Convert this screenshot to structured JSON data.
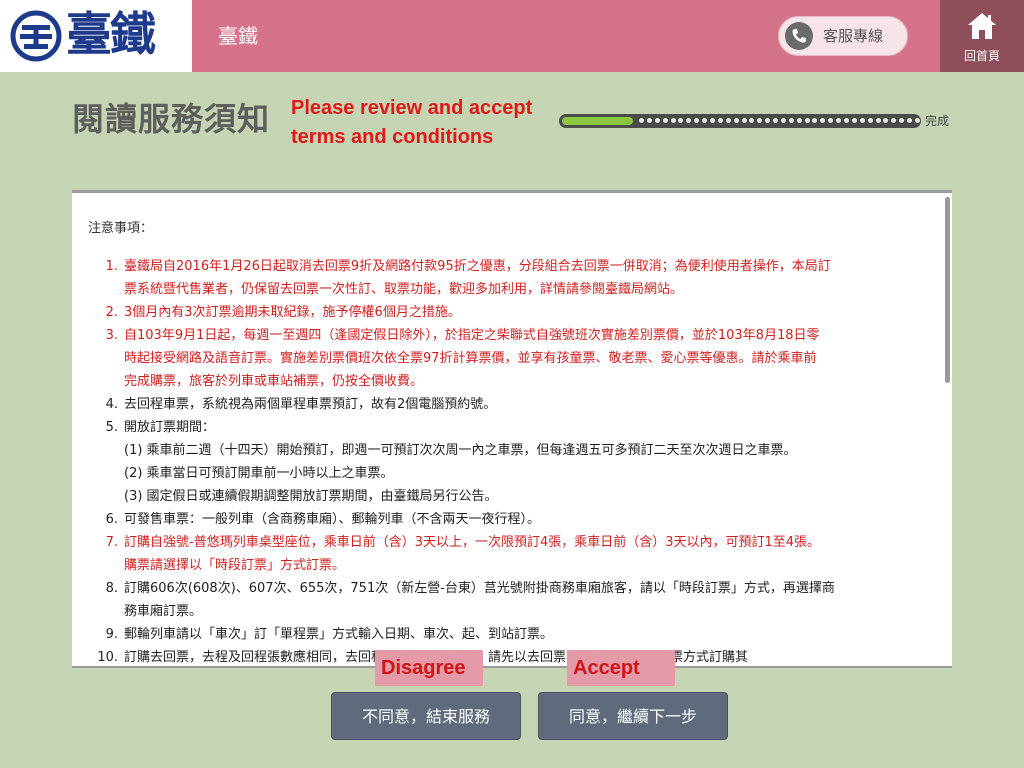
{
  "header": {
    "logo_text": "臺鐵",
    "title": "臺鐵",
    "service_label": "客服專線",
    "home_label": "回首頁"
  },
  "page": {
    "title": "閱讀服務須知",
    "overlay_title": "Please review and accept terms and conditions",
    "progress_label": "完成",
    "progress_fraction": 0.2
  },
  "notice": {
    "heading": "注意事項：",
    "items": [
      {
        "num": "1.",
        "red": true,
        "lines": [
          "臺鐵局自2016年1月26日起取消去回票9折及網路付款95折之優惠，分段組合去回票一併取消；為便利使用者操作，本局訂",
          "票系統暨代售業者，仍保留去回票一次性訂、取票功能，歡迎多加利用，詳情請參閱臺鐵局網站。"
        ]
      },
      {
        "num": "2.",
        "red": true,
        "lines": [
          "3個月內有3次訂票逾期未取紀錄，施予停權6個月之措施。"
        ]
      },
      {
        "num": "3.",
        "red": true,
        "lines": [
          "自103年9月1日起，每週一至週四（逢國定假日除外），於指定之柴聯式自強號班次實施差別票價，並於103年8月18日零",
          "時起接受網路及語音訂票。實施差別票價班次依全票97折計算票價，並享有孩童票、敬老票、愛心票等優惠。請於乘車前",
          "完成購票，旅客於列車或車站補票，仍按全價收費。"
        ]
      },
      {
        "num": "4.",
        "red": false,
        "lines": [
          "去回程車票，系統視為兩個單程車票預訂，故有2個電腦預約號。"
        ]
      },
      {
        "num": "5.",
        "red": false,
        "lines": [
          "開放訂票期間：",
          "(1) 乘車前二週（十四天）開始預訂，即週一可預訂次次周一內之車票，但每逢週五可多預訂二天至次次週日之車票。",
          "(2) 乘車當日可預訂開車前一小時以上之車票。",
          "(3) 國定假日或連續假期調整開放訂票期間，由臺鐵局另行公告。"
        ]
      },
      {
        "num": "6.",
        "red": false,
        "lines": [
          "可發售車票：一般列車（含商務車廂）、郵輪列車（不含兩天一夜行程）。"
        ]
      },
      {
        "num": "7.",
        "red": true,
        "lines": [
          "訂購自強號-普悠瑪列車桌型座位，乘車日前（含）3天以上，一次限預訂4張，乘車日前（含）3天以內，可預訂1至4張。",
          "購票請選擇以「時段訂票」方式訂票。"
        ]
      },
      {
        "num": "8.",
        "red": false,
        "lines": [
          "訂購606次(608次)、607次、655次，751次（新左營-台東）莒光號附掛商務車廂旅客，請以「時段訂票」方式，再選擇商",
          "務車廂訂票。"
        ]
      },
      {
        "num": "9.",
        "red": false,
        "lines": [
          "郵輪列車請以「車次」訂「單程票」方式輸入日期、車次、起、到站訂票。"
        ]
      },
      {
        "num": "10.",
        "red": false,
        "lines": [
          "訂購去回票，去程及回程張數應相同，去回程張數不一致行程，請先以去回票訂票後，再以單程票方式訂購其"
        ]
      }
    ]
  },
  "overlays": {
    "disagree": "Disagree",
    "accept": "Accept"
  },
  "buttons": {
    "disagree": "不同意，結束服務",
    "accept": "同意，繼續下一步"
  }
}
